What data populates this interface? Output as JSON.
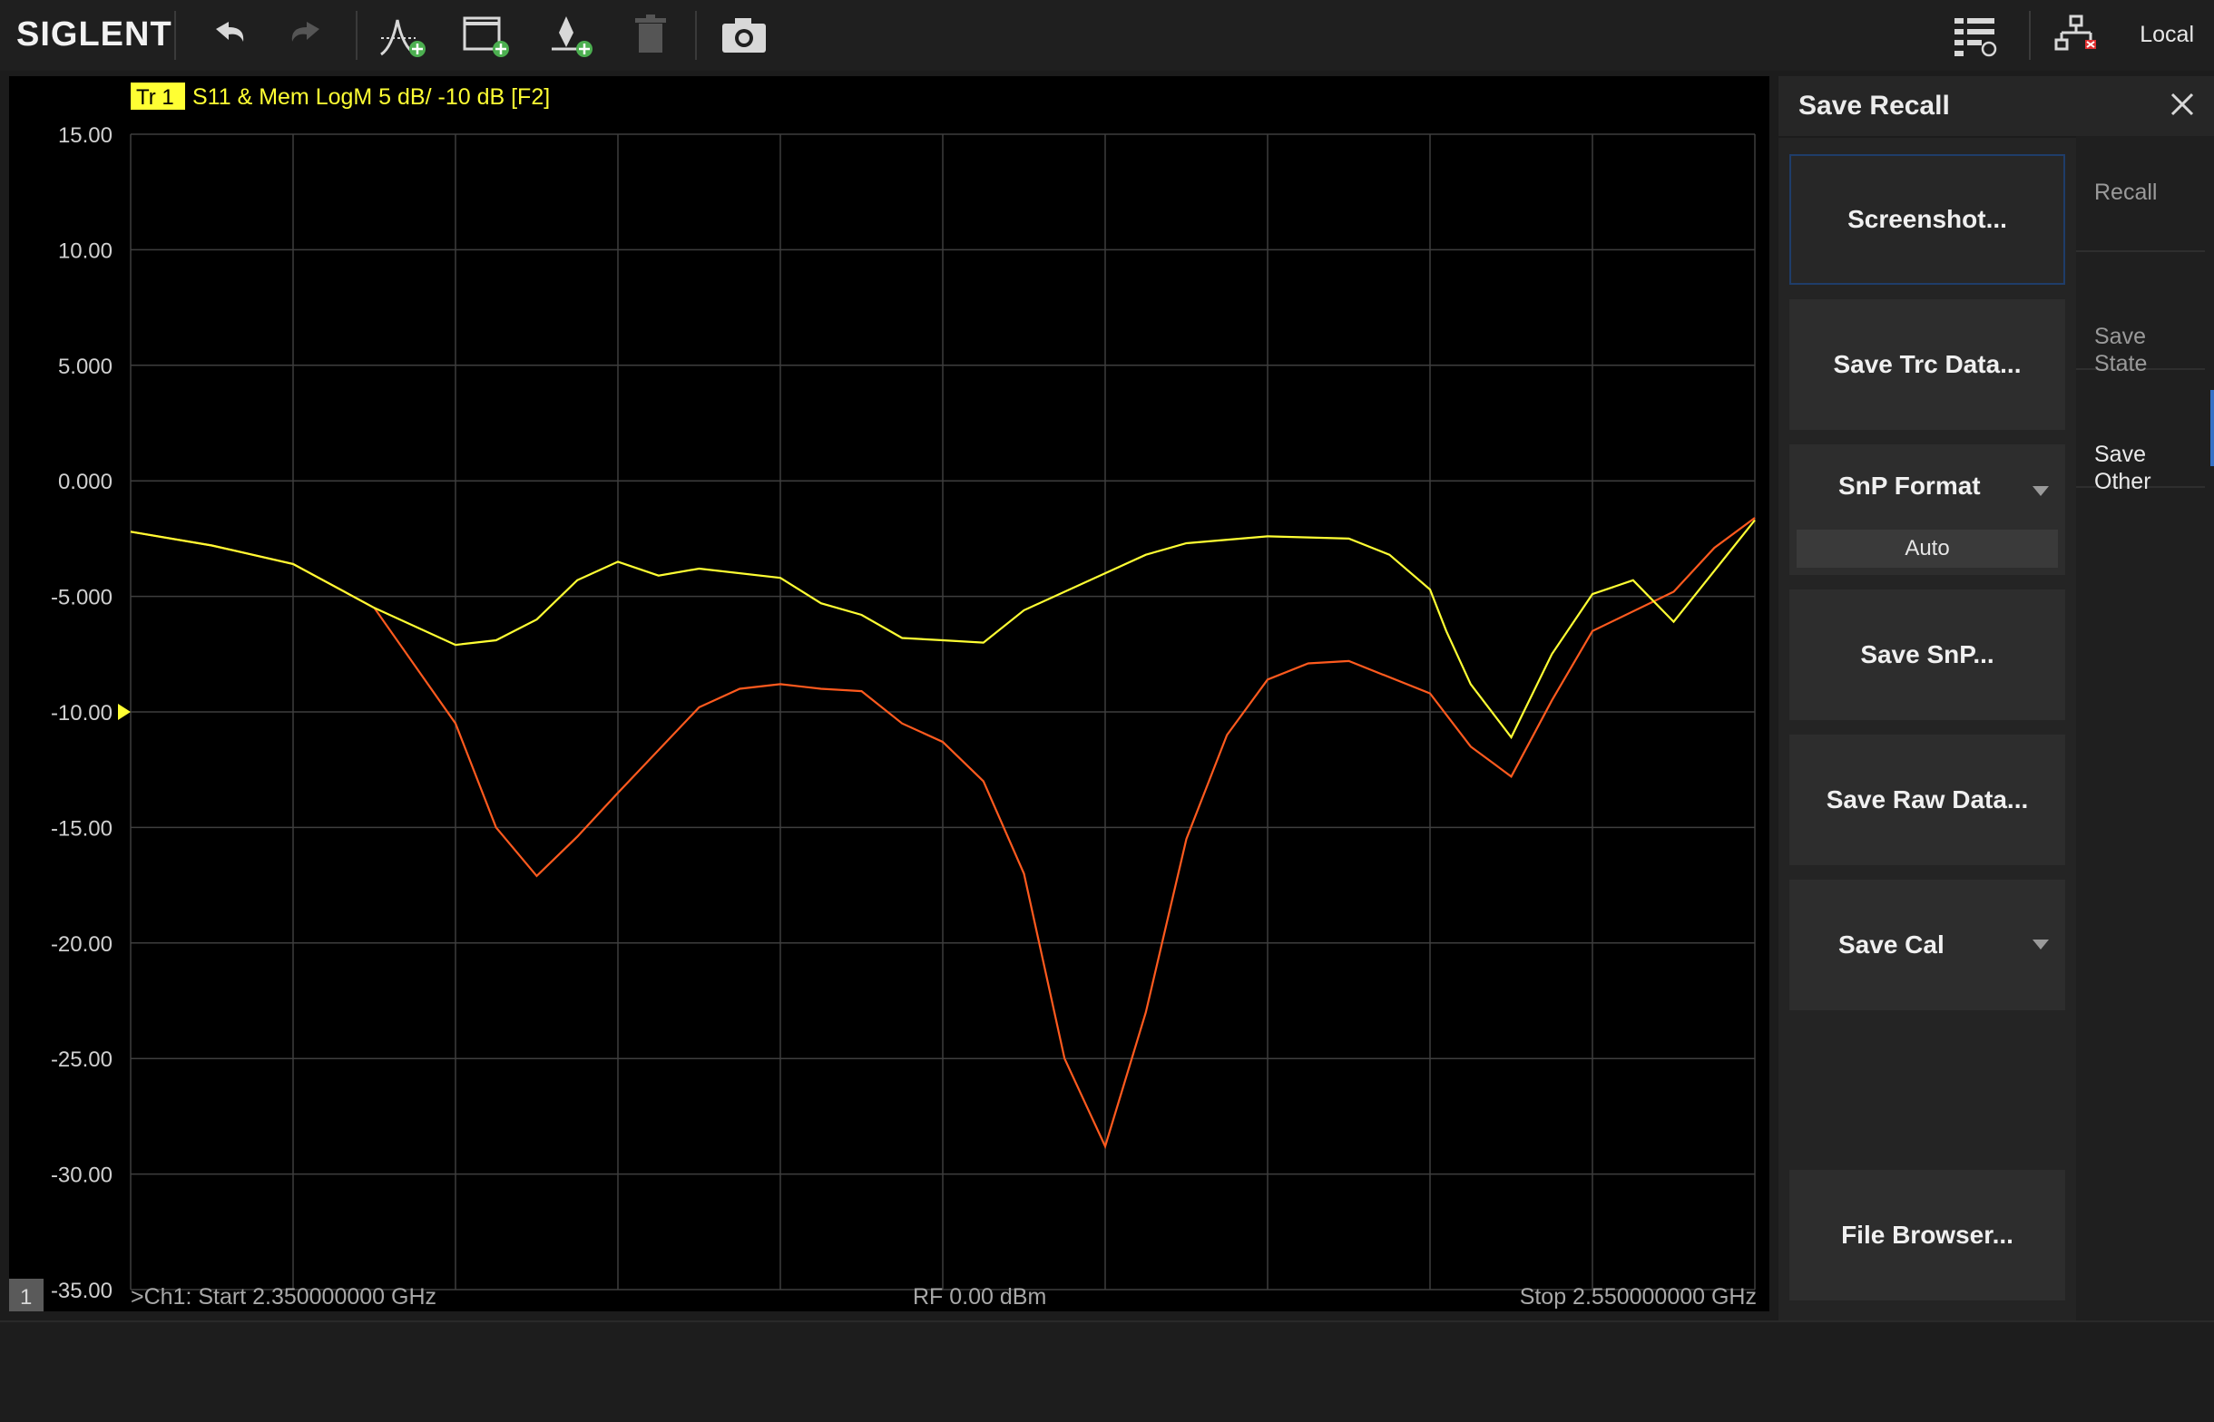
{
  "toolbar": {
    "brand": "SIGLENT",
    "remote_label": "Local",
    "icons": [
      "undo-icon",
      "redo-icon",
      "add-trace-icon",
      "add-window-icon",
      "add-marker-icon",
      "delete-icon",
      "camera-icon",
      "menu-layout-icon",
      "network-disconnected-icon"
    ]
  },
  "chart": {
    "trace_badge": "Tr 1",
    "trace_title": "S11 & Mem LogM 5 dB/ -10 dB [F2]",
    "channel_number": "1",
    "start_label": ">Ch1: Start 2.350000000 GHz",
    "power_label": "RF 0.00 dBm",
    "stop_label": "Stop 2.550000000 GHz"
  },
  "chart_data": {
    "type": "line",
    "title": "S11 & Mem LogM 5 dB/ -10 dB [F2]",
    "x_unit": "GHz",
    "xlim": [
      2.35,
      2.55
    ],
    "ylim": [
      -35,
      15
    ],
    "y_ticks": [
      "15.00",
      "10.00",
      "5.000",
      "0.000",
      "-5.000",
      "-10.00",
      "-15.00",
      "-20.00",
      "-25.00",
      "-30.00",
      "-35.00"
    ],
    "reference_level": -10,
    "grid": true,
    "series": [
      {
        "name": "S11",
        "color": "#ffff33",
        "x": [
          2.35,
          2.36,
          2.365,
          2.37,
          2.38,
          2.39,
          2.395,
          2.4,
          2.405,
          2.41,
          2.415,
          2.42,
          2.43,
          2.435,
          2.44,
          2.445,
          2.45,
          2.455,
          2.46,
          2.47,
          2.475,
          2.48,
          2.49,
          2.5,
          2.505,
          2.51,
          2.512,
          2.515,
          2.52,
          2.525,
          2.53,
          2.535,
          2.54,
          2.55
        ],
        "y": [
          -2.2,
          -2.8,
          -3.2,
          -3.6,
          -5.5,
          -7.1,
          -6.9,
          -6.0,
          -4.3,
          -3.5,
          -4.1,
          -3.8,
          -4.2,
          -5.3,
          -5.8,
          -6.8,
          -6.9,
          -7.0,
          -5.6,
          -4.0,
          -3.2,
          -2.7,
          -2.4,
          -2.5,
          -3.2,
          -4.7,
          -6.5,
          -8.8,
          -11.1,
          -7.5,
          -4.9,
          -4.3,
          -6.1,
          -1.7
        ]
      },
      {
        "name": "Mem",
        "color": "#ff5a1e",
        "x": [
          2.35,
          2.36,
          2.365,
          2.37,
          2.38,
          2.39,
          2.395,
          2.4,
          2.405,
          2.41,
          2.42,
          2.425,
          2.43,
          2.435,
          2.44,
          2.445,
          2.45,
          2.455,
          2.46,
          2.465,
          2.47,
          2.475,
          2.48,
          2.485,
          2.49,
          2.495,
          2.5,
          2.51,
          2.515,
          2.52,
          2.525,
          2.53,
          2.54,
          2.545,
          2.55
        ],
        "y": [
          -2.2,
          -2.8,
          -3.2,
          -3.6,
          -5.5,
          -10.5,
          -15.0,
          -17.1,
          -15.4,
          -13.5,
          -9.8,
          -9.0,
          -8.8,
          -9.0,
          -9.1,
          -10.5,
          -11.3,
          -13.0,
          -17.0,
          -25.0,
          -28.8,
          -23.0,
          -15.5,
          -11.0,
          -8.6,
          -7.9,
          -7.8,
          -9.2,
          -11.5,
          -12.8,
          -9.5,
          -6.5,
          -4.8,
          -2.9,
          -1.6
        ]
      }
    ]
  },
  "panel": {
    "title": "Save Recall",
    "buttons": {
      "screenshot": "Screenshot...",
      "save_trc": "Save Trc Data...",
      "snp_format": "SnP Format",
      "snp_value": "Auto",
      "save_snp": "Save SnP...",
      "save_raw": "Save Raw Data...",
      "save_cal": "Save Cal",
      "file_browser": "File Browser..."
    },
    "side_tabs": {
      "recall": "Recall",
      "save_state": "Save\nState",
      "save_other": "Save\nOther"
    }
  }
}
